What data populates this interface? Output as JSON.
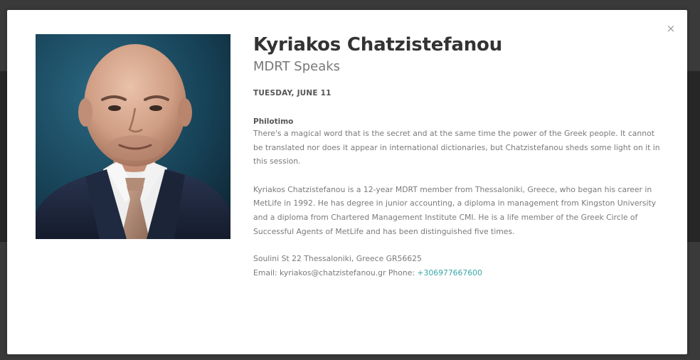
{
  "speaker": {
    "name": "Kyriakos Chatzistefanou",
    "program": "MDRT Speaks",
    "photo_alt": "Kyriakos Chatzistefanou portrait"
  },
  "session": {
    "date": "TUESDAY, JUNE 11",
    "title": "Philotimo",
    "description": "There's a magical word that is the secret and at the same time the power of the Greek people. It cannot be translated nor does it appear in international dictionaries, but Chatzistefanou sheds some light on it in this session."
  },
  "bio": "Kyriakos Chatzistefanou is a 12-year MDRT member from Thessaloniki, Greece, who began his career in MetLife in 1992. He has degree in junior accounting, a diploma in management from Kingston University and a diploma from Chartered Management Institute CMI. He is a life member of the Greek Circle of Successful Agents of MetLife and has been distinguished five times.",
  "contact": {
    "address": "Soulini St 22 Thessaloniki, Greece GR56625",
    "email_label": "Email: ",
    "email": "kyriakos@chatzistefanou.gr",
    "phone_label": " Phone: ",
    "phone": "+306977667600"
  },
  "icons": {
    "close": "×"
  },
  "colors": {
    "link": "#3ba6a6",
    "photo_bg": "#1d4d63"
  }
}
